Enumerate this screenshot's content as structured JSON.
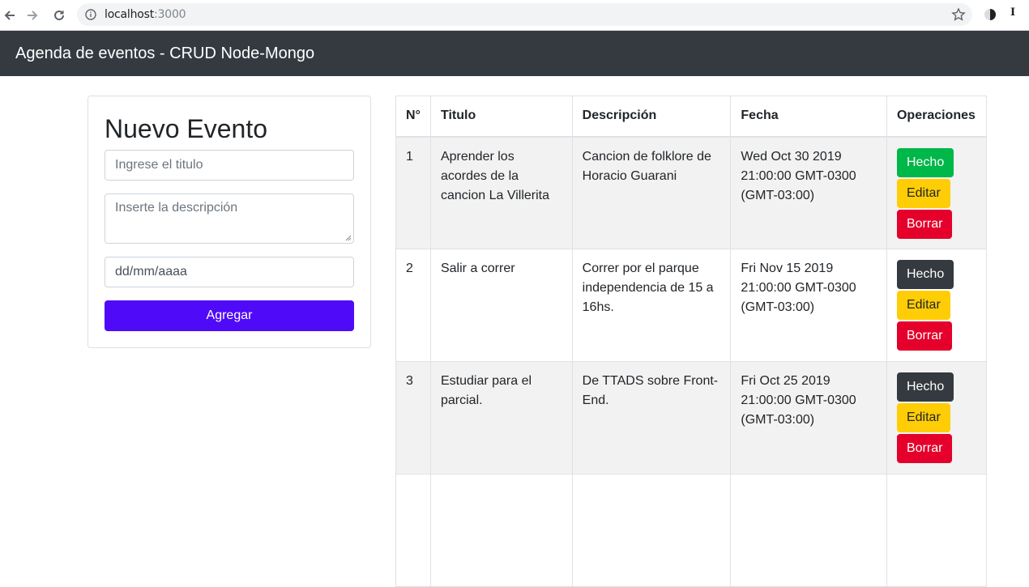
{
  "browser": {
    "url_host": "localhost",
    "url_port": ":3000",
    "icons": [
      "back-icon",
      "forward-icon",
      "reload-icon",
      "info-icon",
      "star-icon",
      "extension-icon"
    ],
    "extension_label": "I"
  },
  "navbar": {
    "brand": "Agenda de eventos - CRUD Node-Mongo"
  },
  "form": {
    "heading": "Nuevo Evento",
    "title_placeholder": "Ingrese el titulo",
    "description_placeholder": "Inserte la descripción",
    "date_value": "dd/mm/aaaa",
    "submit_label": "Agregar"
  },
  "table": {
    "headers": [
      "N°",
      "Titulo",
      "Descripción",
      "Fecha",
      "Operaciones"
    ],
    "rows": [
      {
        "num": "1",
        "title": "Aprender los acordes de la cancion La Villerita",
        "description": "Cancion de folklore de Horacio Guarani",
        "date": "Wed Oct 30 2019 21:00:00 GMT-0300 (GMT-03:00)",
        "done": true,
        "done_label": "Hecho",
        "edit_label": "Editar",
        "delete_label": "Borrar"
      },
      {
        "num": "2",
        "title": "Salir a correr",
        "description": "Correr por el parque independencia de 15 a 16hs.",
        "date": "Fri Nov 15 2019 21:00:00 GMT-0300 (GMT-03:00)",
        "done": false,
        "done_label": "Hecho",
        "edit_label": "Editar",
        "delete_label": "Borrar"
      },
      {
        "num": "3",
        "title": "Estudiar para el parcial.",
        "description": "De TTADS sobre Front-End.",
        "date": "Fri Oct 25 2019 21:00:00 GMT-0300 (GMT-03:00)",
        "done": false,
        "done_label": "Hecho",
        "edit_label": "Editar",
        "delete_label": "Borrar"
      }
    ]
  },
  "colors": {
    "navbar": "#343a40",
    "submit": "#4f0af7",
    "done_active": "#00b74a",
    "done": "#343a40",
    "edit": "#ffcd05",
    "delete": "#e4002b"
  }
}
